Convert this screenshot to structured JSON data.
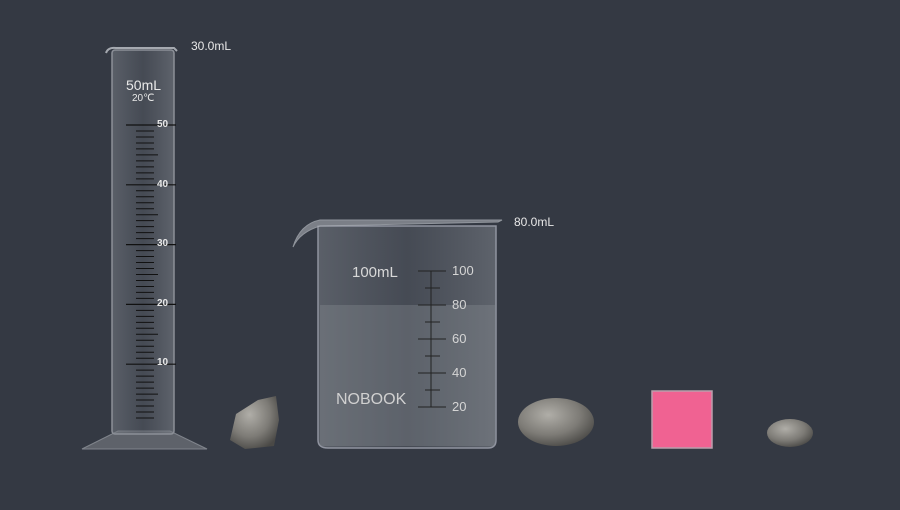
{
  "cylinder": {
    "volume_readout": "30.0mL",
    "capacity_label": "50mL",
    "temp_label": "20℃",
    "scale_labels": [
      "50",
      "40",
      "30",
      "20",
      "10"
    ],
    "liquid_ml": 0
  },
  "beaker": {
    "volume_readout": "80.0mL",
    "capacity_label": "100mL",
    "brand_label": "NOBOOK",
    "scale_labels": [
      "100",
      "80",
      "60",
      "40",
      "20"
    ],
    "liquid_ml": 80
  },
  "objects": {
    "pink_block_color": "#f06292",
    "background_color": "#343943"
  }
}
